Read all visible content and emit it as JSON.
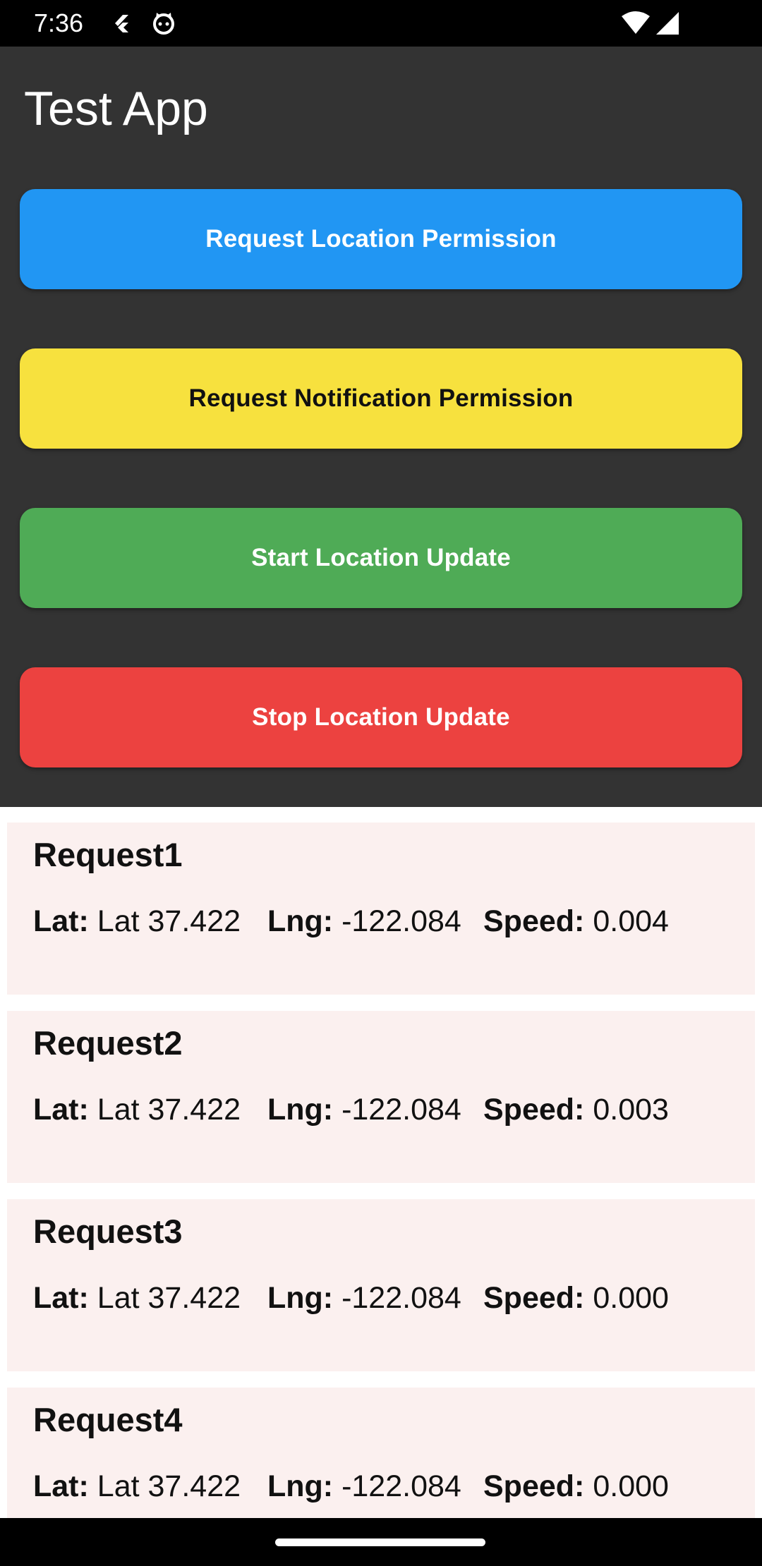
{
  "status_bar": {
    "time": "7:36",
    "icons": [
      "flutter-icon",
      "cat-face-icon",
      "wifi-icon",
      "cell-signal-icon"
    ]
  },
  "app": {
    "title": "Test App",
    "background_color": "#333333"
  },
  "buttons": [
    {
      "label": "Request Location Permission",
      "color": "#2196F3",
      "text_color": "#ffffff"
    },
    {
      "label": "Request Notification Permission",
      "color": "#F7E13E",
      "text_color": "#111111"
    },
    {
      "label": "Start Location Update",
      "color": "#4FAB56",
      "text_color": "#ffffff"
    },
    {
      "label": "Stop Location Update",
      "color": "#EC4240",
      "text_color": "#ffffff"
    }
  ],
  "labels": {
    "lat": "Lat:",
    "lng": "Lng:",
    "speed": "Speed:"
  },
  "requests": [
    {
      "title": "Request1",
      "lat": "Lat 37.422",
      "lng": "-122.084",
      "speed": "0.004"
    },
    {
      "title": "Request2",
      "lat": "Lat 37.422",
      "lng": "-122.084",
      "speed": "0.003"
    },
    {
      "title": "Request3",
      "lat": "Lat 37.422",
      "lng": "-122.084",
      "speed": "0.000"
    },
    {
      "title": "Request4",
      "lat": "Lat 37.422",
      "lng": "-122.084",
      "speed": "0.000"
    }
  ]
}
